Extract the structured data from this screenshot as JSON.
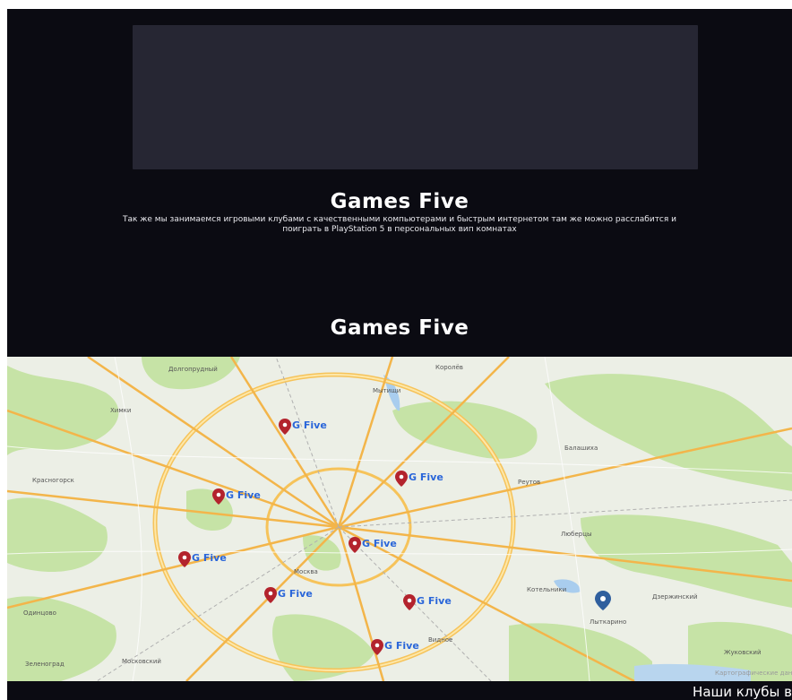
{
  "hero": {
    "title": "Games Five",
    "description": "Так же мы занимаемся игровыми клубами с качественными компьютерами и быстрым интернетом там же можно расслабится и поиграть в PlayStation 5 в персональных вип комнатах"
  },
  "section": {
    "title": "Games Five"
  },
  "map": {
    "pins": [
      {
        "label": "G Five"
      },
      {
        "label": "G Five"
      },
      {
        "label": "G Five"
      },
      {
        "label": "G Five"
      },
      {
        "label": "G Five"
      },
      {
        "label": "G Five"
      },
      {
        "label": "G Five"
      },
      {
        "label": "G Five"
      }
    ],
    "places": [
      "Долгопрудный",
      "Мытищи",
      "Королёв",
      "Химки",
      "Балашиха",
      "Красногорск",
      "Реутов",
      "Люберцы",
      "Одинцово",
      "Лыткарино",
      "Котельники",
      "Видное",
      "Москва",
      "Московский",
      "Жуковский",
      "Дзержинский",
      "Зеленоград"
    ],
    "attribution": "Картографические данные"
  },
  "footer": {
    "text": "Наши клубы в"
  },
  "colors": {
    "background": "#0b0b12",
    "media_placeholder": "#262633",
    "pin": "#b3232d",
    "pin_label": "#2a66d9",
    "user_marker": "#2f5f9e"
  }
}
